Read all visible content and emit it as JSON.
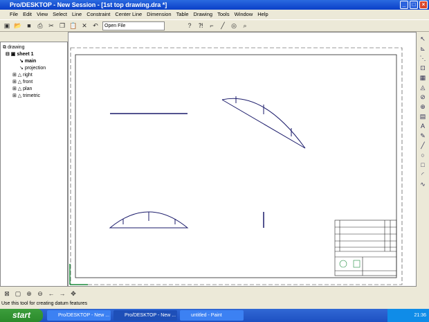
{
  "window": {
    "title": "Pro/DESKTOP - New Session - [1st top drawing.dra *]"
  },
  "menu": [
    "File",
    "Edit",
    "View",
    "Select",
    "Line",
    "Constraint",
    "Center Line",
    "Dimension",
    "Table",
    "Drawing",
    "Tools",
    "Window",
    "Help"
  ],
  "toolbar": {
    "open_file": "Open File"
  },
  "tree": {
    "root": "drawing",
    "sheet": "sheet 1",
    "items": [
      "main",
      "projection",
      "right",
      "front",
      "plan",
      "trimetric"
    ]
  },
  "status": "Use this tool for creating datum features",
  "taskbar": {
    "start": "start",
    "tasks": [
      "Pro/DESKTOP - New ...",
      "Pro/DESKTOP - New ...",
      "untitled - Paint"
    ],
    "clock": "21:36"
  },
  "colors": {
    "titlebar": "#0a3fc8",
    "axis": "#1a8a3a",
    "geometry": "#1a1a6a"
  }
}
